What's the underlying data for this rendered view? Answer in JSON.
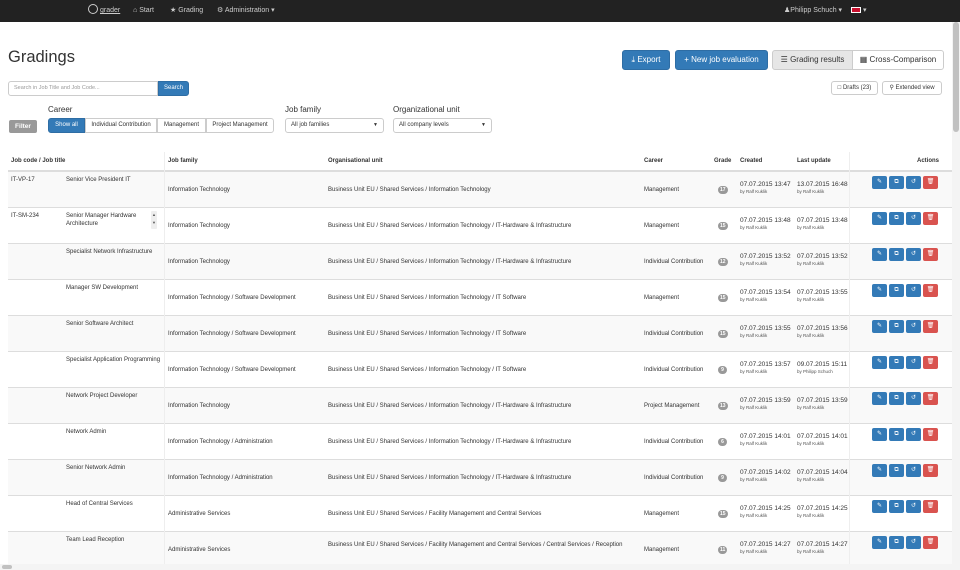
{
  "nav": {
    "brand": "grader",
    "start": "Start",
    "grading": "Grading",
    "administration": "Administration ▾",
    "user": "Philipp Schuch ▾",
    "lang": "▾"
  },
  "page": {
    "title": "Gradings"
  },
  "toolbar": {
    "export": "Export",
    "new_eval": "+ New job evaluation",
    "results": "Grading results",
    "cross": "Cross-Comparison",
    "drafts": "Drafts (23)",
    "extended": "Extended view"
  },
  "search": {
    "placeholder": "Search in Job Title and Job Code...",
    "button": "Search"
  },
  "filters": {
    "badge": "Filter",
    "career_label": "Career",
    "career_options": [
      "Show all",
      "Individual Contribution",
      "Management",
      "Project Management"
    ],
    "job_family_label": "Job family",
    "job_family_value": "All job families",
    "org_label": "Organizational unit",
    "org_value": "All company levels"
  },
  "table": {
    "headers": {
      "code": "Job code / Job title",
      "family": "Job family",
      "org": "Organisational unit",
      "career": "Career",
      "grade": "Grade",
      "created": "Created",
      "updated": "Last update",
      "actions": "Actions"
    },
    "rows": [
      {
        "code": "IT-VP-17",
        "title": "Senior Vice President IT",
        "family": "Information Technology",
        "org": "Business Unit EU / Shared Services / Information Technology",
        "career": "Management",
        "grade": "17",
        "created": "07.07.2015 13:47",
        "created_by": "by Ralf Kuklik",
        "updated": "13.07.2015 16:48",
        "updated_by": "by Ralf Kuklik"
      },
      {
        "code": "IT-SM-234",
        "title": "Senior Manager Hardware Architecture",
        "family": "Information Technology",
        "org": "Business Unit EU / Shared Services / Information Technology / IT-Hardware & Infrastructure",
        "career": "Management",
        "grade": "15",
        "created": "07.07.2015 13:48",
        "created_by": "by Ralf Kuklik",
        "updated": "07.07.2015 13:48",
        "updated_by": "by Ralf Kuklik"
      },
      {
        "code": "",
        "title": "Specialist Network Infrastructure",
        "family": "Information Technology",
        "org": "Business Unit EU / Shared Services / Information Technology / IT-Hardware & Infrastructure",
        "career": "Individual Contribution",
        "grade": "12",
        "created": "07.07.2015 13:52",
        "created_by": "by Ralf Kuklik",
        "updated": "07.07.2015 13:52",
        "updated_by": "by Ralf Kuklik"
      },
      {
        "code": "",
        "title": "Manager SW Development",
        "family": "Information Technology / Software Development",
        "org": "Business Unit EU / Shared Services / Information Technology / IT Software",
        "career": "Management",
        "grade": "15",
        "created": "07.07.2015 13:54",
        "created_by": "by Ralf Kuklik",
        "updated": "07.07.2015 13:55",
        "updated_by": "by Ralf Kuklik"
      },
      {
        "code": "",
        "title": "Senior Software Architect",
        "family": "Information Technology / Software Development",
        "org": "Business Unit EU / Shared Services / Information Technology / IT Software",
        "career": "Individual Contribution",
        "grade": "15",
        "created": "07.07.2015 13:55",
        "created_by": "by Ralf Kuklik",
        "updated": "07.07.2015 13:56",
        "updated_by": "by Ralf Kuklik"
      },
      {
        "code": "",
        "title": "Specialist Application Programming",
        "family": "Information Technology / Software Development",
        "org": "Business Unit EU / Shared Services / Information Technology / IT Software",
        "career": "Individual Contribution",
        "grade": "9",
        "created": "07.07.2015 13:57",
        "created_by": "by Ralf Kuklik",
        "updated": "09.07.2015 15:11",
        "updated_by": "by Philipp Schuch"
      },
      {
        "code": "",
        "title": "Network Project Developer",
        "family": "Information Technology",
        "org": "Business Unit EU / Shared Services / Information Technology / IT-Hardware & Infrastructure",
        "career": "Project Management",
        "grade": "13",
        "created": "07.07.2015 13:59",
        "created_by": "by Ralf Kuklik",
        "updated": "07.07.2015 13:59",
        "updated_by": "by Ralf Kuklik"
      },
      {
        "code": "",
        "title": "Network Admin",
        "family": "Information Technology / Administration",
        "org": "Business Unit EU / Shared Services / Information Technology / IT-Hardware & Infrastructure",
        "career": "Individual Contribution",
        "grade": "6",
        "created": "07.07.2015 14:01",
        "created_by": "by Ralf Kuklik",
        "updated": "07.07.2015 14:01",
        "updated_by": "by Ralf Kuklik"
      },
      {
        "code": "",
        "title": "Senior Network Admin",
        "family": "Information Technology / Administration",
        "org": "Business Unit EU / Shared Services / Information Technology / IT-Hardware & Infrastructure",
        "career": "Individual Contribution",
        "grade": "9",
        "created": "07.07.2015 14:02",
        "created_by": "by Ralf Kuklik",
        "updated": "07.07.2015 14:04",
        "updated_by": "by Ralf Kuklik"
      },
      {
        "code": "",
        "title": "Head of Central Services",
        "family": "Administrative Services",
        "org": "Business Unit EU / Shared Services / Facility Management and Central Services",
        "career": "Management",
        "grade": "15",
        "created": "07.07.2015 14:25",
        "created_by": "by Ralf Kuklik",
        "updated": "07.07.2015 14:25",
        "updated_by": "by Ralf Kuklik"
      },
      {
        "code": "",
        "title": "Team Lead Reception",
        "family": "Administrative Services",
        "org": "Business Unit EU / Shared Services / Facility Management and Central Services / Central Services / Reception",
        "career": "Management",
        "grade": "11",
        "created": "07.07.2015 14:27",
        "created_by": "by Ralf Kuklik",
        "updated": "07.07.2015 14:27",
        "updated_by": "by Ralf Kuklik"
      }
    ]
  },
  "colors": {
    "primary": "#337ab7",
    "danger": "#d9534f",
    "navbar": "#222222",
    "badge": "#999999"
  },
  "icons": [
    "user-icon",
    "home-icon",
    "star-icon",
    "gear-icon",
    "download-icon",
    "list-icon",
    "table-icon",
    "file-icon",
    "search-icon",
    "pencil-icon",
    "copy-icon",
    "history-icon",
    "trash-icon",
    "uk-flag-icon"
  ]
}
